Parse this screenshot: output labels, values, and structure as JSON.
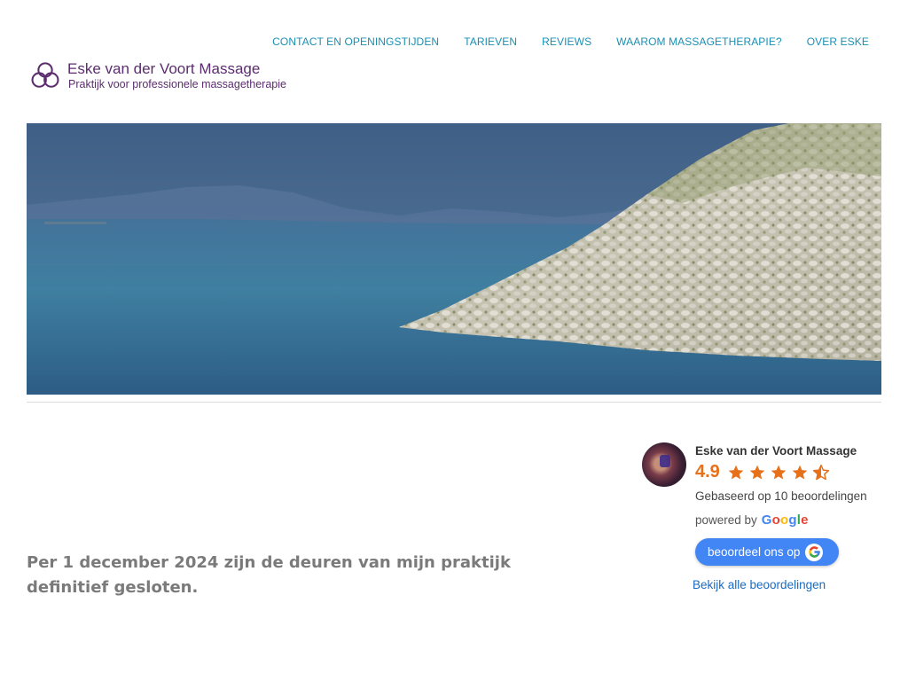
{
  "nav": {
    "items": [
      {
        "label": "CONTACT EN OPENINGSTIJDEN"
      },
      {
        "label": "TARIEVEN"
      },
      {
        "label": "REVIEWS"
      },
      {
        "label": "WAAROM MASSAGETHERAPIE?"
      },
      {
        "label": "OVER ESKE"
      }
    ]
  },
  "logo": {
    "title": "Eske van der Voort Massage",
    "subtitle": "Praktijk voor professionele massagetherapie",
    "icon": "triquetra-icon"
  },
  "colors": {
    "nav_link": "#1a8fb3",
    "logo": "#5b2d6e",
    "message": "#7a7a7a",
    "rating": "#e7711b",
    "google_blue": "#4285f4"
  },
  "main": {
    "message": "Per 1 december 2024 zijn de deuren van mijn praktijk definitief gesloten."
  },
  "reviews": {
    "business_name": "Eske van der Voort Massage",
    "score": "4.9",
    "stars": 4.5,
    "based_on": "Gebaseerd op 10 beoordelingen",
    "powered_by": "powered by",
    "google_word": "Google",
    "review_button": "beoordeel ons op",
    "view_all": "Bekijk alle beoordelingen"
  }
}
